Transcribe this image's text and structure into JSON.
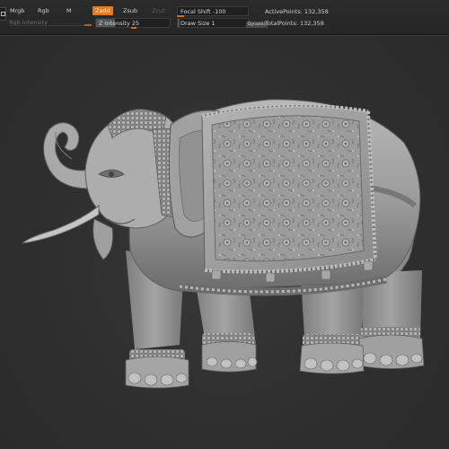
{
  "toolbar": {
    "buttons": {
      "mrgb": "Mrgb",
      "rgb": "Rgb",
      "m": "M",
      "zadd": "Zadd",
      "zsub": "Zsub",
      "zcut": "Zcut"
    },
    "rgb_intensity_label": "Rgb Intensity",
    "z_intensity": {
      "label": "Z Intensity",
      "value": 25
    },
    "focal_shift": {
      "label": "Focal Shift",
      "value": -100
    },
    "draw_size": {
      "label": "Draw Size",
      "value": 1
    },
    "dynamic_label": "Dynamic",
    "active_points": {
      "label": "ActivePoints:",
      "value": "132,358"
    },
    "total_points": {
      "label": "TotalPoints:",
      "value": "132,358"
    },
    "z_intensity_text": "Z Intensity 25",
    "focal_shift_text": "Focal Shift -100",
    "draw_size_text": "Draw Size 1",
    "active_points_text": "ActivePoints: 132,358",
    "total_points_text": "TotalPoints: 132,358"
  },
  "colors": {
    "accent": "#e77a20",
    "background": "#303030",
    "toolbar": "#272727",
    "model": "#9a9a9a"
  },
  "canvas": {
    "model_subject": "elephant-sculpt-icon"
  }
}
